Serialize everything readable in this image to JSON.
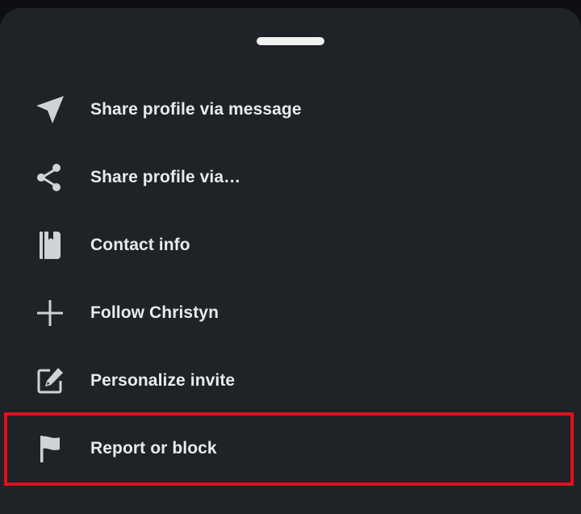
{
  "sheet": {
    "items": [
      {
        "label": "Share profile via message",
        "icon": "send-icon"
      },
      {
        "label": "Share profile via…",
        "icon": "share-icon"
      },
      {
        "label": "Contact info",
        "icon": "contact-book-icon"
      },
      {
        "label": "Follow Christyn",
        "icon": "plus-icon"
      },
      {
        "label": "Personalize invite",
        "icon": "edit-icon"
      },
      {
        "label": "Report or block",
        "icon": "flag-icon"
      }
    ]
  },
  "colors": {
    "sheet_background": "#1f2226",
    "text": "#e9eaec",
    "icon": "#cfd2d6",
    "highlight": "#e0111e"
  }
}
